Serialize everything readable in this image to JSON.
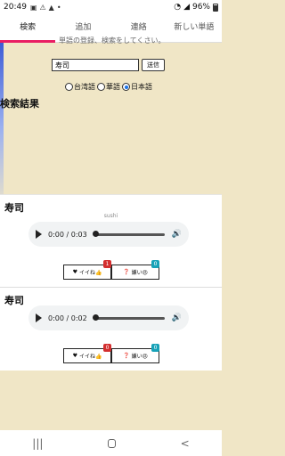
{
  "status_bar": {
    "time": "20:49",
    "icons": [
      "▣",
      "⚠",
      "▲",
      "•"
    ],
    "battery": "96%"
  },
  "tabs": [
    {
      "label": "検索",
      "active": true
    },
    {
      "label": "追加",
      "active": false
    },
    {
      "label": "連絡",
      "active": false
    },
    {
      "label": "新しい単語",
      "active": false
    }
  ],
  "cut_off_text": "単語の登録、検索をしてくさい。",
  "search": {
    "value": "寿司",
    "submit_label": "送信"
  },
  "language_options": [
    {
      "label": "台湾語",
      "checked": false
    },
    {
      "label": "華語",
      "checked": false
    },
    {
      "label": "日本語",
      "checked": true
    }
  ],
  "results_title": "検索結果",
  "results": [
    {
      "title": "寿司",
      "subtitle": "sushi",
      "audio_time": "0:00 / 0:03",
      "like_label": "イイね👍",
      "like_count": "1",
      "dislike_label": "嫌い😠",
      "dislike_count": "0"
    },
    {
      "title": "寿司",
      "subtitle": "",
      "audio_time": "0:00 / 0:02",
      "like_label": "イイね👍",
      "like_count": "0",
      "dislike_label": "嫌い😠",
      "dislike_count": "0"
    }
  ],
  "nav": {
    "recents": "|||",
    "home": "",
    "back": "<"
  },
  "colors": {
    "background": "#f0e6c6",
    "tab_indicator": "#e91e63",
    "badge_like": "#d32f2f",
    "badge_dislike": "#17a2b8"
  }
}
